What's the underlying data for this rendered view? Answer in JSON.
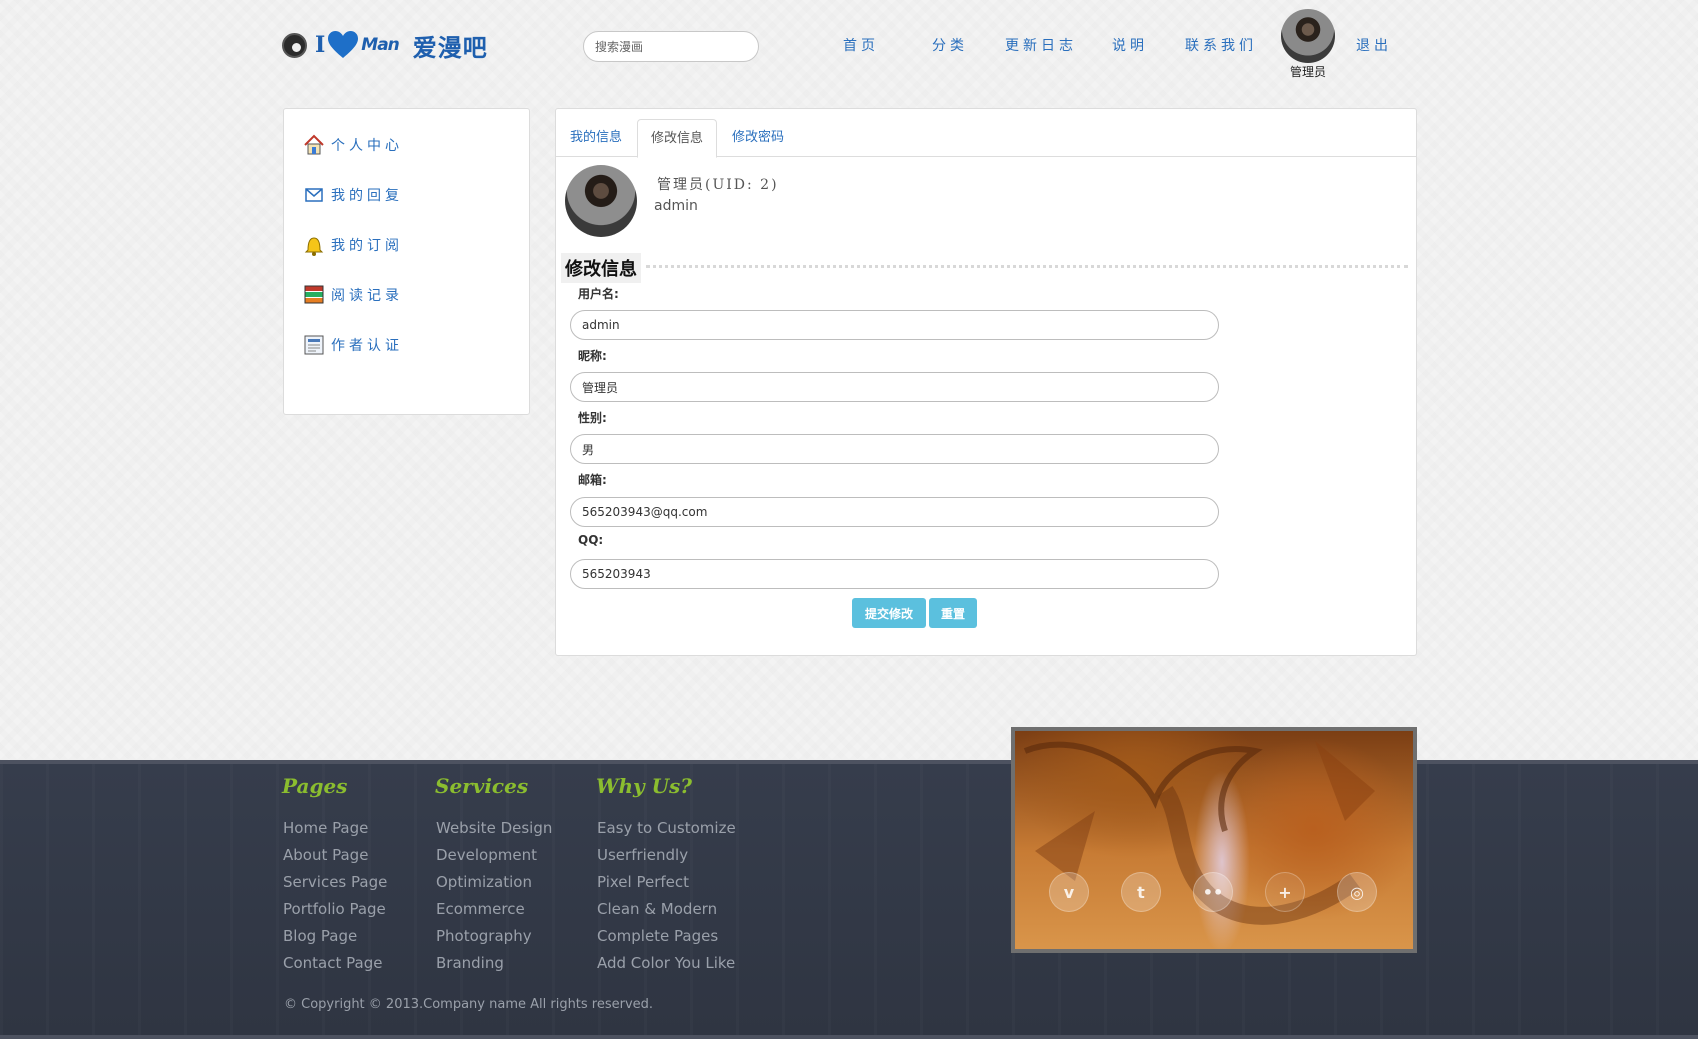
{
  "header": {
    "logo_i": "I",
    "logo_man": "Man",
    "logo_cn": "爱漫吧",
    "search_placeholder": "搜索漫画",
    "nav": [
      "首页",
      "分类",
      "更新日志",
      "说明",
      "联系我们",
      "退出"
    ],
    "user_label": "管理员"
  },
  "sidebar": {
    "items": [
      {
        "label": "个人中心",
        "icon": "house-icon"
      },
      {
        "label": "我的回复",
        "icon": "envelope-icon"
      },
      {
        "label": "我的订阅",
        "icon": "bell-icon"
      },
      {
        "label": "阅读记录",
        "icon": "books-icon"
      },
      {
        "label": "作者认证",
        "icon": "document-icon"
      }
    ]
  },
  "main": {
    "tabs": [
      "我的信息",
      "修改信息",
      "修改密码"
    ],
    "active_tab": "修改信息",
    "profile": {
      "name_line": "管理员(UID:   2)",
      "login": "admin"
    },
    "section_title": "修改信息",
    "fields": [
      {
        "label": "用户名:",
        "value": "admin"
      },
      {
        "label": "昵称:",
        "value": "管理员"
      },
      {
        "label": "性别:",
        "value": "男"
      },
      {
        "label": "邮箱:",
        "value": "565203943@qq.com"
      },
      {
        "label": "QQ:",
        "value": "565203943"
      }
    ],
    "submit_label": "提交修改",
    "reset_label": "重置"
  },
  "footer": {
    "columns": [
      {
        "title": "Pages",
        "links": [
          "Home Page",
          "About Page",
          "Services Page",
          "Portfolio Page",
          "Blog Page",
          "Contact Page"
        ]
      },
      {
        "title": "Services",
        "links": [
          "Website Design",
          "Development",
          "Optimization",
          "Ecommerce",
          "Photography",
          "Branding"
        ]
      },
      {
        "title": "Why Us?",
        "links": [
          "Easy to Customize",
          "Userfriendly",
          "Pixel Perfect",
          "Clean & Modern",
          "Complete Pages",
          "Add Color You Like"
        ]
      }
    ],
    "copyright": "© Copyright © 2013.Company name All rights reserved.",
    "social": [
      {
        "icon": "vimeo-icon",
        "glyph": "v"
      },
      {
        "icon": "twitter-icon",
        "glyph": "t"
      },
      {
        "icon": "flickr-icon",
        "glyph": "••"
      },
      {
        "icon": "plus-icon",
        "glyph": "+"
      },
      {
        "icon": "dribbble-icon",
        "glyph": "◎"
      }
    ]
  },
  "colors": {
    "link": "#2a6fbd",
    "accent_button": "#5bc0de",
    "footer_title": "#8bbd2f",
    "footer_bg": "#333a48"
  }
}
